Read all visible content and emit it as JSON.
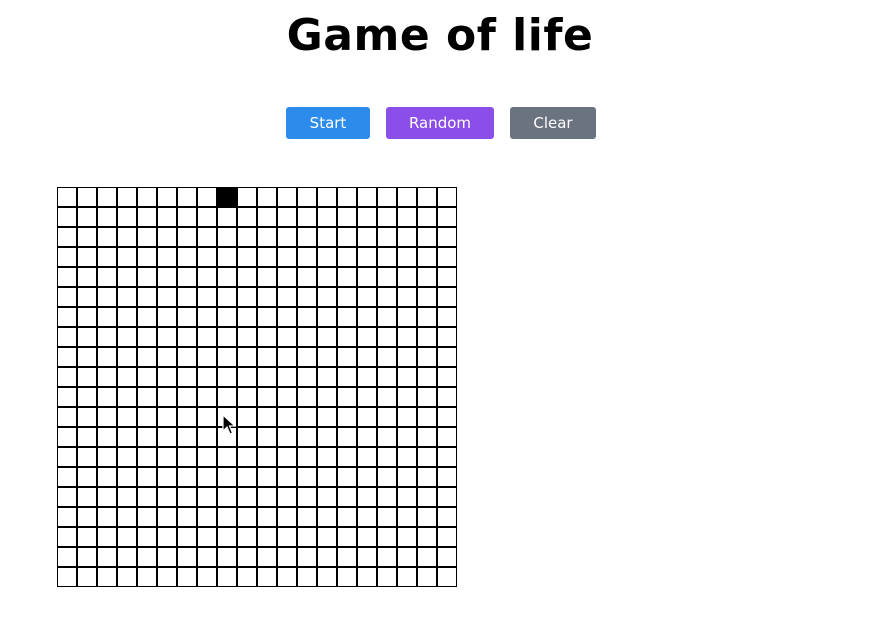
{
  "title": "Game of life",
  "buttons": {
    "start_label": "Start",
    "random_label": "Random",
    "clear_label": "Clear"
  },
  "colors": {
    "start": "#2d8ceb",
    "random": "#8b4ee8",
    "clear": "#6b7280",
    "alive": "#000000",
    "dead": "#ffffff"
  },
  "grid": {
    "rows": 20,
    "cols": 20,
    "cells": [
      "00000000100000000000",
      "00000000000000000000",
      "00000000000000000000",
      "00000000000000000000",
      "00000000000000000000",
      "00000000000000000000",
      "00000000000000000000",
      "00000000000000000000",
      "00000000000000000000",
      "00000000000000000000",
      "00000000000000000000",
      "00000000000000000000",
      "00000000000000000000",
      "00000000000000000000",
      "00000000000000000000",
      "00000000000000000000",
      "00000000000000000000",
      "00000000000000000000",
      "00000000000000000000",
      "00000000000000000000"
    ]
  }
}
